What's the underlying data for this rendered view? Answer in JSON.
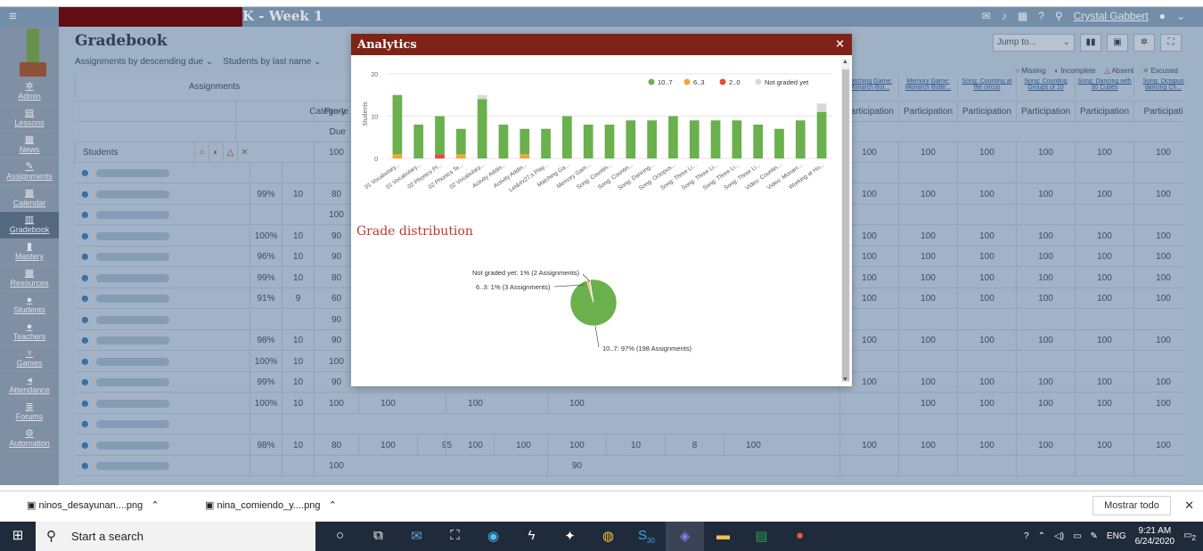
{
  "header": {
    "title": "K - Week 1",
    "user": "Crystal Gabbert"
  },
  "sidebar": {
    "items": [
      {
        "label": "Admin",
        "icon": "gear-icon"
      },
      {
        "label": "Lessons",
        "icon": "lessons-icon"
      },
      {
        "label": "News",
        "icon": "news-icon"
      },
      {
        "label": "Assignments",
        "icon": "assignments-icon"
      },
      {
        "label": "Calendar",
        "icon": "calendar-icon"
      },
      {
        "label": "Gradebook",
        "icon": "gradebook-icon"
      },
      {
        "label": "Mastery",
        "icon": "mastery-icon"
      },
      {
        "label": "Resources",
        "icon": "resources-icon"
      },
      {
        "label": "Students",
        "icon": "students-icon"
      },
      {
        "label": "Teachers",
        "icon": "teachers-icon"
      },
      {
        "label": "Games",
        "icon": "games-icon"
      },
      {
        "label": "Attendance",
        "icon": "attendance-icon"
      },
      {
        "label": "Forums",
        "icon": "forums-icon"
      },
      {
        "label": "Automation",
        "icon": "automation-icon"
      }
    ]
  },
  "gradebook": {
    "title": "Gradebook",
    "sort_assignments": "Assignments by descending due",
    "sort_students": "Students by last name",
    "jump_placeholder": "Jump to...",
    "legend": {
      "missing": "Missing",
      "incomplete": "Incomplete",
      "absent": "Absent",
      "excused": "Excused"
    },
    "headers": {
      "assignments": "Assignments",
      "category": "Category",
      "due": "Due",
      "students": "Students",
      "pre": "Pre-te"
    },
    "columns": [
      "Matching Game: Monarch But...",
      "Memory Game: Monarch Butte...",
      "Song: Counting at the circus",
      "Song: Counting Groups of 10",
      "Song: Dancing with 30 Cubes",
      "Song: Octopus dancing Ch..."
    ],
    "categories": [
      "Participation",
      "Participation",
      "Participation",
      "Participation",
      "Participation",
      "Participati"
    ],
    "max": "100",
    "rows": [
      {
        "pct": "",
        "count": "",
        "v1": "",
        "right": [
          "",
          "",
          "",
          "",
          "",
          ""
        ]
      },
      {
        "pct": "99%",
        "count": "10",
        "v1": "80",
        "right": [
          "100",
          "100",
          "100",
          "100",
          "100",
          "100"
        ]
      },
      {
        "pct": "",
        "count": "",
        "v1": "100",
        "right": [
          "",
          "",
          "",
          "",
          "",
          ""
        ]
      },
      {
        "pct": "100%",
        "count": "10",
        "v1": "90",
        "right": [
          "100",
          "100",
          "100",
          "100",
          "100",
          "100"
        ]
      },
      {
        "pct": "96%",
        "count": "10",
        "v1": "90",
        "right": [
          "100",
          "100",
          "100",
          "100",
          "100",
          "100"
        ]
      },
      {
        "pct": "99%",
        "count": "10",
        "v1": "80",
        "right": [
          "100",
          "100",
          "100",
          "100",
          "100",
          "100"
        ]
      },
      {
        "pct": "91%",
        "count": "9",
        "v1": "60",
        "right": [
          "100",
          "100",
          "100",
          "100",
          "100",
          "100"
        ]
      },
      {
        "pct": "",
        "count": "",
        "v1": "90",
        "right": [
          "",
          "",
          "",
          "",
          "",
          ""
        ]
      },
      {
        "pct": "98%",
        "count": "10",
        "v1": "90",
        "right": [
          "100",
          "100",
          "100",
          "100",
          "100",
          "100"
        ]
      },
      {
        "pct": "100%",
        "count": "10",
        "v1": "100",
        "right": [
          "",
          "",
          "",
          "",
          "",
          ""
        ]
      },
      {
        "pct": "99%",
        "count": "10",
        "v1": "90",
        "right": [
          "100",
          "100",
          "100",
          "100",
          "100",
          "100"
        ]
      },
      {
        "pct": "100%",
        "count": "10",
        "v1": "100",
        "right": [
          "",
          "100",
          "100",
          "100",
          "100",
          "100"
        ]
      },
      {
        "pct": "",
        "count": "",
        "v1": "",
        "right": [
          "",
          "",
          "",
          "",
          "",
          ""
        ]
      },
      {
        "pct": "98%",
        "count": "10",
        "v1": "80",
        "right": [
          "100",
          "100",
          "100",
          "100",
          "100",
          "100"
        ]
      },
      {
        "pct": "",
        "count": "",
        "v1": "100",
        "right": [
          "",
          "",
          "",
          "",
          "",
          ""
        ]
      }
    ],
    "visible_under_modal": {
      "row11": [
        "100",
        "100",
        "100"
      ],
      "row13": [
        "100",
        "95",
        "100",
        "100",
        "100",
        "10",
        "8",
        "100"
      ],
      "row14": [
        "90"
      ]
    }
  },
  "modal": {
    "title": "Analytics",
    "close": "×",
    "grade_distribution_title": "Grade distribution"
  },
  "chart_data": [
    {
      "type": "bar",
      "ylabel": "Students",
      "ylim": [
        0,
        20
      ],
      "yticks": [
        0,
        10,
        20
      ],
      "legend": [
        "10..7",
        "6..3",
        "2..0",
        "Not graded yet"
      ],
      "legend_colors": [
        "#6ab04c",
        "#f0a830",
        "#e74c3c",
        "#d9d9d9"
      ],
      "categories": [
        "01 Vocabulary...",
        "01 Vocabulary...",
        "02 Phonics Pr...",
        "02 Phonics Te...",
        "02 Vocabulary...",
        "Activity Addin...",
        "Activity Addin...",
        "Let&#x27;s Play...",
        "Matching Ga...",
        "Memory Gam...",
        "Song: Countin...",
        "Song: Countin...",
        "Song: Dancing...",
        "Song: Octopus...",
        "Song: Three Li...",
        "Song: Three Li...",
        "Song: Three Li...",
        "Song: Three Li...",
        "Video: Countin...",
        "Video: Monarc...",
        "Working at Ho..."
      ],
      "series": [
        {
          "name": "10..7",
          "values": [
            14,
            8,
            9,
            6,
            14,
            8,
            6,
            7,
            10,
            8,
            8,
            9,
            9,
            10,
            9,
            9,
            9,
            8,
            7,
            9,
            11
          ]
        },
        {
          "name": "6..3",
          "values": [
            1,
            0,
            0,
            1,
            0,
            0,
            1,
            0,
            0,
            0,
            0,
            0,
            0,
            0,
            0,
            0,
            0,
            0,
            0,
            0,
            0
          ]
        },
        {
          "name": "2..0",
          "values": [
            0,
            0,
            1,
            0,
            0,
            0,
            0,
            0,
            0,
            0,
            0,
            0,
            0,
            0,
            0,
            0,
            0,
            0,
            0,
            0,
            0
          ]
        },
        {
          "name": "Not graded yet",
          "values": [
            0,
            0,
            0,
            0,
            1,
            0,
            0,
            0,
            0,
            0,
            0,
            0,
            0,
            0,
            0,
            0,
            0,
            0,
            0,
            0,
            2
          ]
        }
      ]
    },
    {
      "type": "pie",
      "title": "Grade distribution",
      "slices": [
        {
          "label": "10..7: 97% (198 Assignments)",
          "value": 198,
          "color": "#6ab04c"
        },
        {
          "label": "6..3: 1% (3 Assignments)",
          "value": 3,
          "color": "#f0a830"
        },
        {
          "label": "Not graded yet: 1% (2 Assignments)",
          "value": 2,
          "color": "#d9d9d9"
        }
      ]
    }
  ],
  "downloads": {
    "file1": "ninos_desayunan....png",
    "file2": "nina_comiendo_y....png",
    "show_all": "Mostrar todo"
  },
  "taskbar": {
    "search": "Start a search",
    "lang": "ENG",
    "time": "9:21 AM",
    "date": "6/24/2020",
    "notif": "2",
    "skype_badge": "30"
  }
}
